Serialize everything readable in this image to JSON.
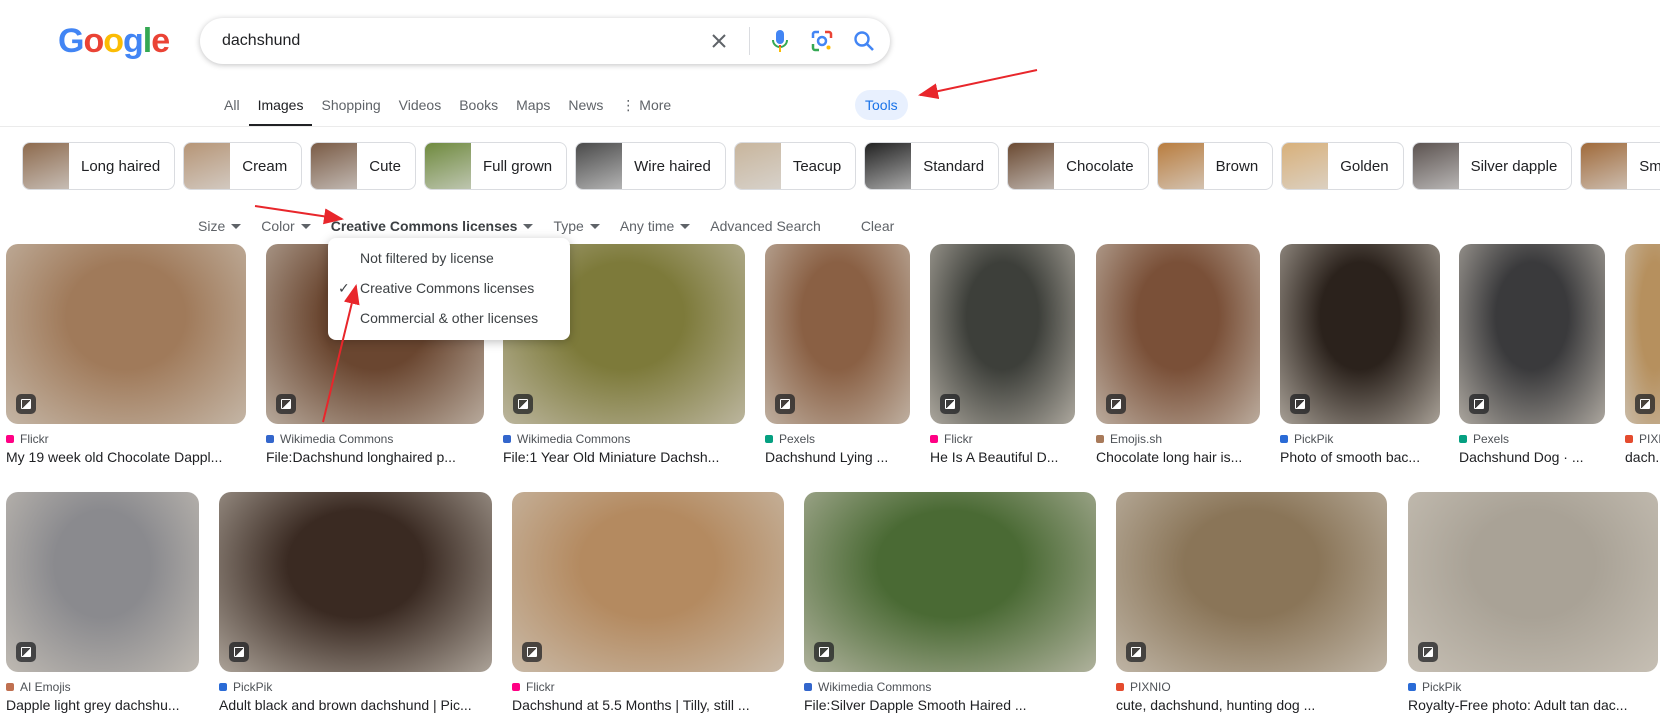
{
  "logo": {
    "letters": [
      "G",
      "o",
      "o",
      "g",
      "l",
      "e"
    ]
  },
  "search": {
    "query": "dachshund"
  },
  "icons": {
    "clear": "close-icon",
    "voice": "microphone-icon",
    "lens": "camera-lens-icon",
    "search": "search-icon"
  },
  "tabs": [
    {
      "label": "All"
    },
    {
      "label": "Images",
      "active": true
    },
    {
      "label": "Shopping"
    },
    {
      "label": "Videos"
    },
    {
      "label": "Books"
    },
    {
      "label": "Maps"
    },
    {
      "label": "News"
    },
    {
      "label": "⋮ More"
    }
  ],
  "tools_label": "Tools",
  "chips": [
    {
      "label": "Long haired",
      "color": "#8d6a4d"
    },
    {
      "label": "Cream",
      "color": "#b69576"
    },
    {
      "label": "Cute",
      "color": "#7a5b45"
    },
    {
      "label": "Full grown",
      "color": "#6f8a3e"
    },
    {
      "label": "Wire haired",
      "color": "#4a4a4a"
    },
    {
      "label": "Teacup",
      "color": "#c8b59c"
    },
    {
      "label": "Standard",
      "color": "#222222"
    },
    {
      "label": "Chocolate",
      "color": "#6b4a32"
    },
    {
      "label": "Brown",
      "color": "#b97d3f"
    },
    {
      "label": "Golden",
      "color": "#d8b07a"
    },
    {
      "label": "Silver dapple",
      "color": "#5c5350"
    },
    {
      "label": "Smoot",
      "color": "#a06a3a"
    }
  ],
  "filters": [
    {
      "label": "Size",
      "caret": true
    },
    {
      "label": "Color",
      "caret": true
    },
    {
      "label": "Creative Commons licenses",
      "caret": true,
      "active": true
    },
    {
      "label": "Type",
      "caret": true
    },
    {
      "label": "Any time",
      "caret": true
    },
    {
      "label": "Advanced Search",
      "caret": false
    },
    {
      "label": "Clear",
      "caret": false
    }
  ],
  "license_menu": {
    "items": [
      "Not filtered by license",
      "Creative Commons licenses",
      "Commercial & other licenses"
    ],
    "selected": "Creative Commons licenses",
    "check_glyph": "✓"
  },
  "results_row1": [
    {
      "source": "Flickr",
      "title": "My 19 week old Chocolate Dappl...",
      "fav": "#ff0084",
      "color": "#a07a5a"
    },
    {
      "source": "Wikimedia Commons",
      "title": "File:Dachshund longhaired p...",
      "fav": "#3366cc",
      "color": "#6a4630"
    },
    {
      "source": "Wikimedia Commons",
      "title": "File:1 Year Old Miniature Dachsh...",
      "fav": "#3366cc",
      "color": "#7d7a3a"
    },
    {
      "source": "Pexels",
      "title": "Dachshund Lying ...",
      "fav": "#05a081",
      "color": "#8a6044"
    },
    {
      "source": "Flickr",
      "title": "He Is A Beautiful D...",
      "fav": "#ff0084",
      "color": "#3d3f3a"
    },
    {
      "source": "Emojis.sh",
      "title": "Chocolate long hair is...",
      "fav": "#a87a5a",
      "color": "#7a5038"
    },
    {
      "source": "PickPik",
      "title": "Photo of smooth bac...",
      "fav": "#2a6bd6",
      "color": "#2b221c"
    },
    {
      "source": "Pexels",
      "title": "Dachshund Dog · ...",
      "fav": "#05a081",
      "color": "#3a3a3c"
    },
    {
      "source": "PIXNIO",
      "title": "dach...",
      "fav": "#e44b2e",
      "color": "#b6905e"
    }
  ],
  "results_row2": [
    {
      "source": "AI Emojis",
      "title": "Dapple light grey dachshu...",
      "fav": "#c07050",
      "color": "#8a8a8e"
    },
    {
      "source": "PickPik",
      "title": "Adult black and brown dachshund | Pic...",
      "fav": "#2a6bd6",
      "color": "#3a2a22"
    },
    {
      "source": "Flickr",
      "title": "Dachshund at 5.5 Months | Tilly, still ...",
      "fav": "#ff0084",
      "color": "#b48a60"
    },
    {
      "source": "Wikimedia Commons",
      "title": "File:Silver Dapple Smooth Haired ...",
      "fav": "#3366cc",
      "color": "#4a6a34"
    },
    {
      "source": "PIXNIO",
      "title": "cute, dachshund, hunting dog ...",
      "fav": "#e44b2e",
      "color": "#8a7558"
    },
    {
      "source": "PickPik",
      "title": "Royalty-Free photo: Adult tan dac...",
      "fav": "#2a6bd6",
      "color": "#a9a296"
    }
  ],
  "colors": {
    "accent": "#1a73e8",
    "annotation": "#e8262b"
  }
}
